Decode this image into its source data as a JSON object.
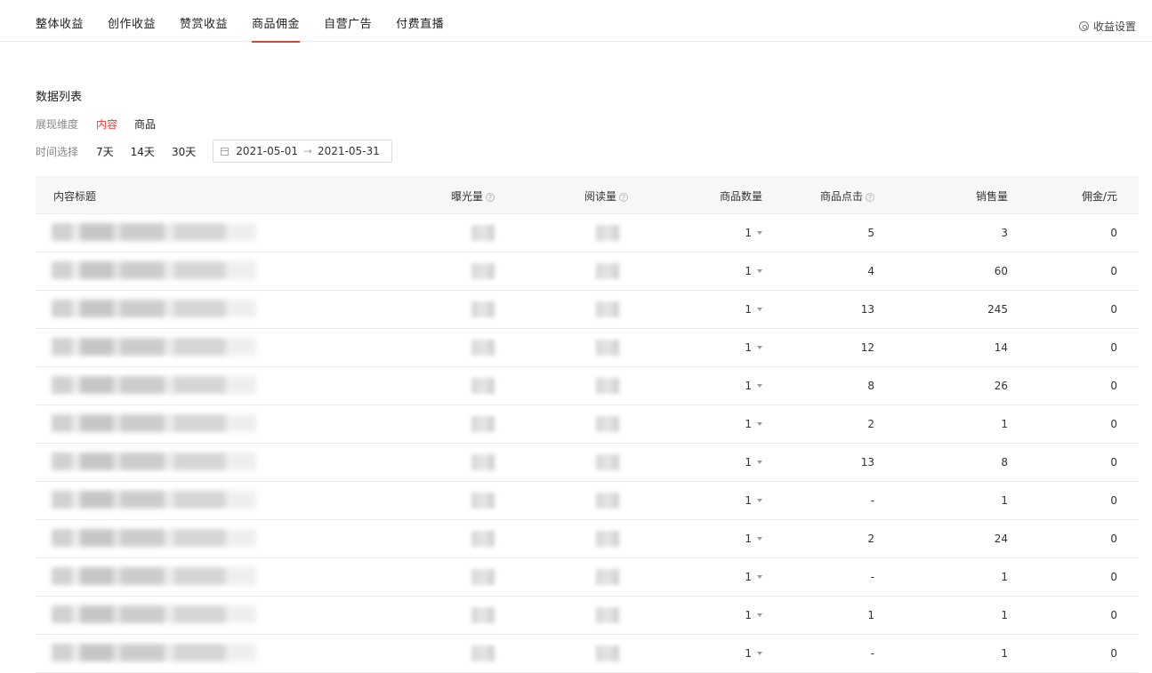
{
  "tabs": [
    {
      "label": "整体收益",
      "active": false
    },
    {
      "label": "创作收益",
      "active": false
    },
    {
      "label": "赞赏收益",
      "active": false
    },
    {
      "label": "商品佣金",
      "active": true
    },
    {
      "label": "自营广告",
      "active": false
    },
    {
      "label": "付费直播",
      "active": false
    }
  ],
  "settings_label": "收益设置",
  "section_title": "数据列表",
  "dimension": {
    "label": "展现维度",
    "options": [
      "内容",
      "商品"
    ],
    "selected": "内容"
  },
  "time": {
    "label": "时间选择",
    "options": [
      "7天",
      "14天",
      "30天"
    ],
    "start": "2021-05-01",
    "separator": "→",
    "end": "2021-05-31"
  },
  "table": {
    "headers": {
      "title": "内容标题",
      "exposure": "曝光量",
      "reads": "阅读量",
      "goods_count": "商品数量",
      "goods_clicks": "商品点击",
      "sales": "销售量",
      "commission": "佣金/元"
    },
    "help_icon": "?",
    "rows": [
      {
        "goods": "1",
        "clicks": "5",
        "sales": "3",
        "commission": "0"
      },
      {
        "goods": "1",
        "clicks": "4",
        "sales": "60",
        "commission": "0"
      },
      {
        "goods": "1",
        "clicks": "13",
        "sales": "245",
        "commission": "0"
      },
      {
        "goods": "1",
        "clicks": "12",
        "sales": "14",
        "commission": "0"
      },
      {
        "goods": "1",
        "clicks": "8",
        "sales": "26",
        "commission": "0"
      },
      {
        "goods": "1",
        "clicks": "2",
        "sales": "1",
        "commission": "0"
      },
      {
        "goods": "1",
        "clicks": "13",
        "sales": "8",
        "commission": "0"
      },
      {
        "goods": "1",
        "clicks": "-",
        "sales": "1",
        "commission": "0"
      },
      {
        "goods": "1",
        "clicks": "2",
        "sales": "24",
        "commission": "0"
      },
      {
        "goods": "1",
        "clicks": "-",
        "sales": "1",
        "commission": "0"
      },
      {
        "goods": "1",
        "clicks": "1",
        "sales": "1",
        "commission": "0"
      },
      {
        "goods": "1",
        "clicks": "-",
        "sales": "1",
        "commission": "0"
      }
    ]
  },
  "colors": {
    "accent": "#e33e33",
    "header_bg": "#f7f7f7",
    "border": "#ececec",
    "muted_text": "#888888"
  },
  "icons": {
    "settings": "settings-circle-icon",
    "calendar": "calendar-icon",
    "help": "help-circle-icon",
    "dropdown": "caret-down-icon"
  }
}
